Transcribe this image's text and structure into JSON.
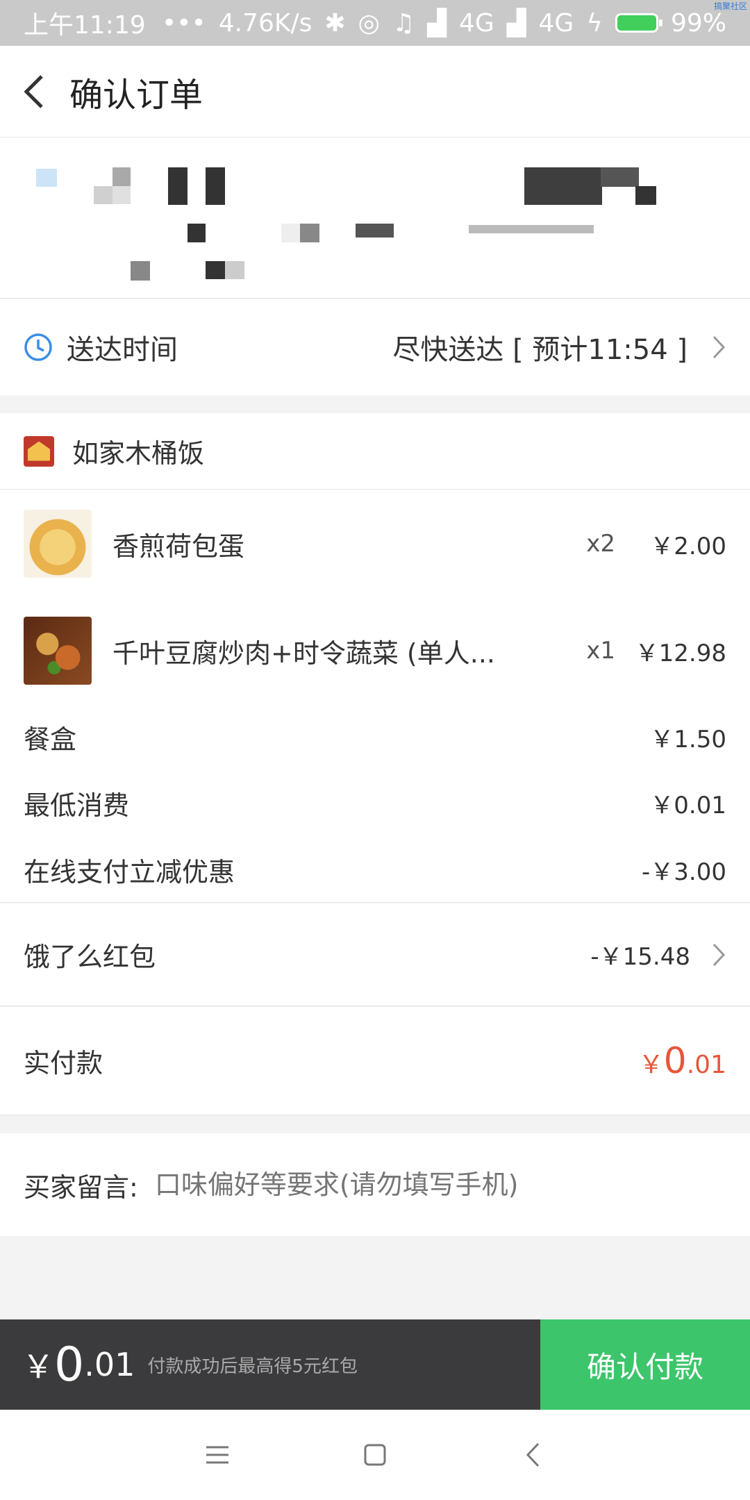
{
  "status_bar": {
    "time": "上午11:19",
    "dots": "•••",
    "speed": "4.76K/s",
    "network1": "4G",
    "network2": "4G",
    "battery": "99%",
    "corner_mark": "搞聚社区"
  },
  "header": {
    "title": "确认订单"
  },
  "delivery": {
    "label": "送达时间",
    "value": "尽快送达 [ 预计11:54 ]"
  },
  "shop": {
    "name": "如家木桶饭"
  },
  "items": [
    {
      "name": "香煎荷包蛋",
      "qty": "x2",
      "price": "￥2.00"
    },
    {
      "name": "千叶豆腐炒肉+时令蔬菜 (单人...",
      "qty": "x1",
      "price": "￥12.98"
    }
  ],
  "fees": [
    {
      "label": "餐盒",
      "value": "￥1.50"
    },
    {
      "label": "最低消费",
      "value": "￥0.01"
    },
    {
      "label": "在线支付立减优惠",
      "value": "-￥3.00"
    }
  ],
  "redpack": {
    "label": "饿了么红包",
    "value": "-￥15.48"
  },
  "actual": {
    "label": "实付款",
    "currency": "￥",
    "integer": "0",
    "decimal": ".01"
  },
  "message": {
    "label": "买家留言:",
    "placeholder": "口味偏好等要求(请勿填写手机)"
  },
  "paybar": {
    "currency": "￥",
    "integer": "0",
    "decimal": ".01",
    "hint": "付款成功后最高得5元红包",
    "confirm": "确认付款"
  },
  "colors": {
    "accent_green": "#3cc56b",
    "price_red": "#e8563a",
    "dark_bar": "#3b3b3d",
    "clock_blue": "#3a8ee6"
  }
}
